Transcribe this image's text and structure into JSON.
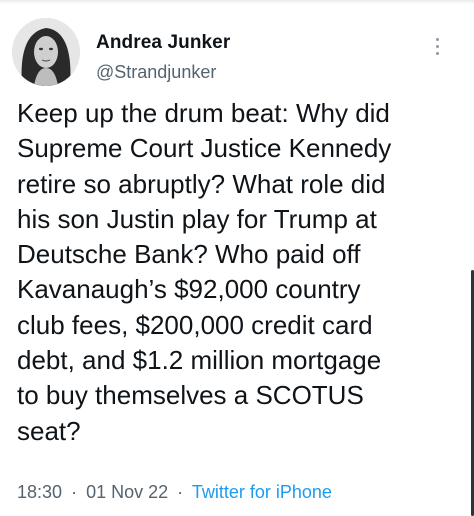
{
  "tweet": {
    "author": {
      "name": "Andrea Junker",
      "handle": "@Strandjunker"
    },
    "text_lines": [
      "Keep up the drum beat: Why did",
      "Supreme Court Justice Kennedy",
      "retire so abruptly? What role did",
      "his son Justin play for Trump at",
      "Deutsche Bank? Who paid off",
      "Kavanaugh’s $92,000 country",
      "club fees, $200,000 credit card",
      "debt, and $1.2 million mortgage",
      "to buy themselves a SCOTUS",
      "seat?"
    ],
    "meta": {
      "time": "18:30",
      "date": "01 Nov 22",
      "source": "Twitter for iPhone",
      "separator": "·"
    },
    "icons": {
      "more": "more-vertical-icon",
      "avatar": "avatar"
    },
    "colors": {
      "text": "#0f1419",
      "secondary": "#536471",
      "link": "#1d9bf0"
    }
  }
}
